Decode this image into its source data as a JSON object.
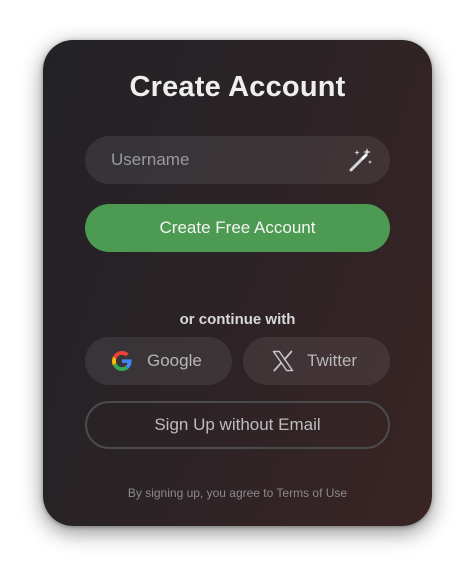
{
  "card": {
    "title": "Create Account"
  },
  "username": {
    "placeholder": "Username",
    "value": ""
  },
  "primary_button": {
    "label": "Create Free Account",
    "color": "#4d9a52"
  },
  "divider": {
    "text": "or continue with"
  },
  "social": {
    "google": {
      "label": "Google",
      "icon": "google-icon"
    },
    "twitter": {
      "label": "Twitter",
      "icon": "x-icon"
    }
  },
  "no_email_button": {
    "label": "Sign Up without Email"
  },
  "footer": {
    "terms_text": "By signing up, you agree to Terms of Use"
  }
}
